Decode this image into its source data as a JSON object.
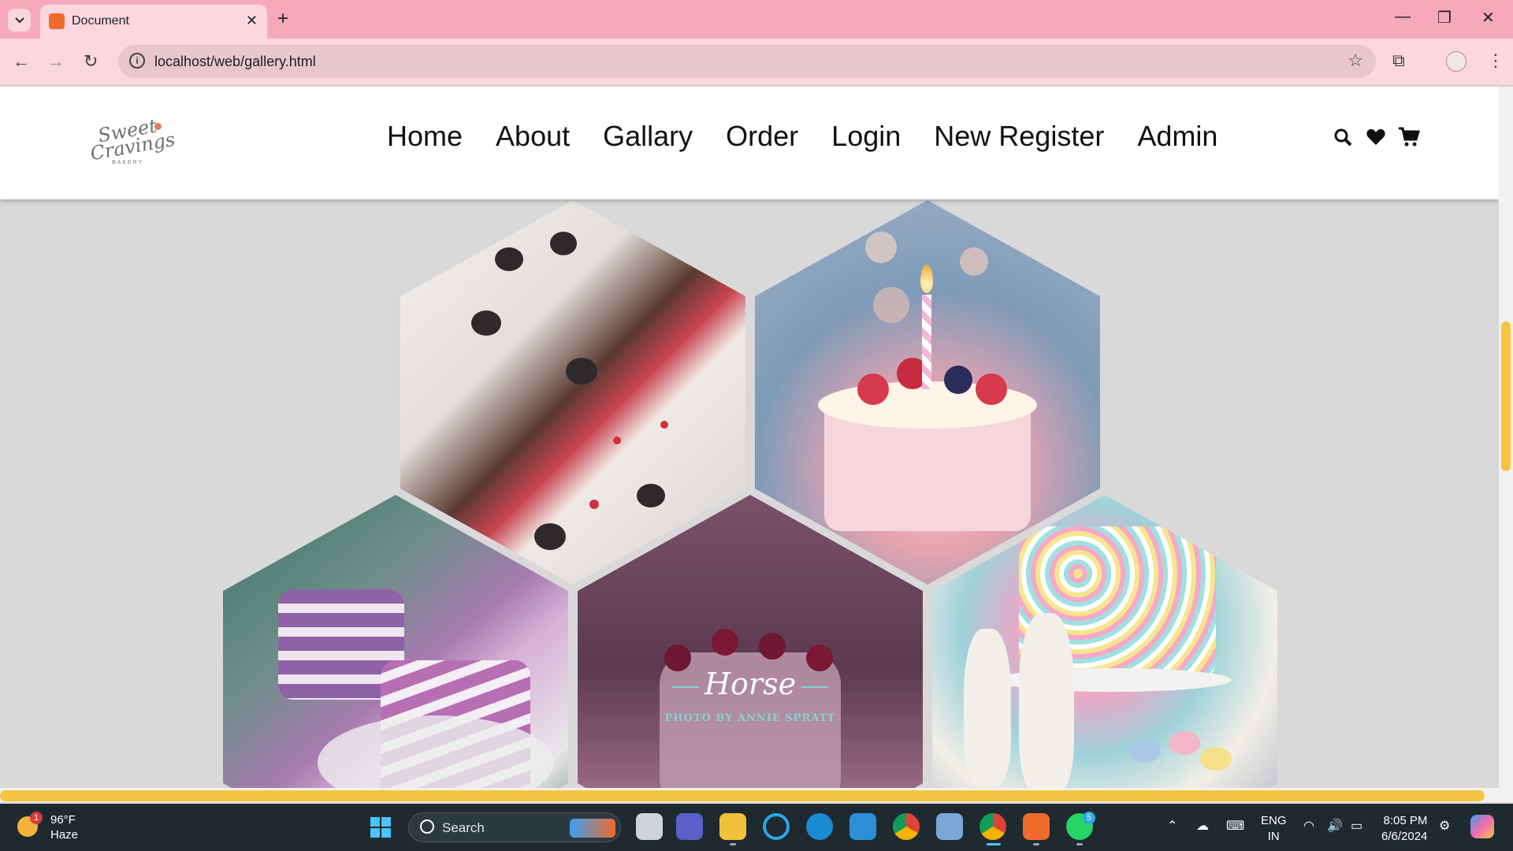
{
  "browser": {
    "tab_title": "Document",
    "url": "localhost/web/gallery.html",
    "new_tab_symbol": "+",
    "close_symbol": "✕"
  },
  "site": {
    "logo": {
      "line1": "Sweet",
      "line2": "Cravings",
      "line3": "BAKERY"
    },
    "nav": [
      "Home",
      "About",
      "Gallary",
      "Order",
      "Login",
      "New Register",
      "Admin"
    ],
    "header_icons": [
      "search-icon",
      "heart-icon",
      "cart-icon"
    ]
  },
  "gallery": {
    "featured_caption": {
      "title": "Horse",
      "subtitle": "PHOTO BY ANNIE SPRATT"
    },
    "images": [
      "chocolate-berry-cake",
      "birthday-candle-cake",
      "blueberry-layer-cake",
      "cherry-cake",
      "easter-sprinkle-cake"
    ]
  },
  "taskbar": {
    "weather": {
      "temp": "96°F",
      "condition": "Haze",
      "badge": "1"
    },
    "search_label": "Search",
    "whatsapp_badge": "5",
    "lang_line1": "ENG",
    "lang_line2": "IN",
    "time": "8:05 PM",
    "date": "6/6/2024"
  },
  "colors": {
    "chrome_pink": "#f7a9bb",
    "scroll_accent": "#f5c542",
    "taskbar": "#1f2a30"
  }
}
